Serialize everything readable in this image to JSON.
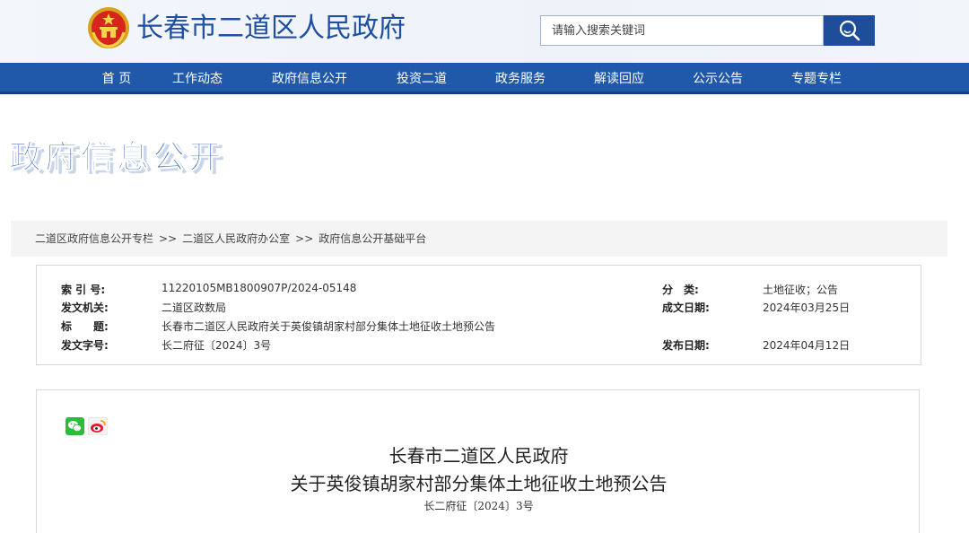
{
  "header": {
    "site_title": "长春市二道区人民政府",
    "search_placeholder": "请输入搜索关键词"
  },
  "nav": {
    "items": [
      "首 页",
      "工作动态",
      "政府信息公开",
      "投资二道",
      "政务服务",
      "解读回应",
      "公示公告",
      "专题专栏"
    ]
  },
  "section": {
    "title": "政府信息公开"
  },
  "breadcrumb": {
    "items": [
      "二道区政府信息公开专栏",
      "二道区人民政府办公室",
      "政府信息公开基础平台"
    ],
    "separator": ">>"
  },
  "meta": {
    "index_label": "索 引 号:",
    "index_value": "11220105MB1800907P/2024-05148",
    "issuer_label": "发文机关:",
    "issuer_value": "二道区政数局",
    "title_label": "标　　题:",
    "title_value": "长春市二道区人民政府关于英俊镇胡家村部分集体土地征收土地预公告",
    "docno_label": "发文字号:",
    "docno_value": "长二府征〔2024〕3号",
    "category_label": "分　类:",
    "category_value": "土地征收；公告",
    "created_label": "成文日期:",
    "created_value": "2024年03月25日",
    "published_label": "发布日期:",
    "published_value": "2024年04月12日"
  },
  "article": {
    "title_line1": "长春市二道区人民政府",
    "title_line2": "关于英俊镇胡家村部分集体土地征收土地预公告",
    "doc_number": "长二府征〔2024〕3号"
  },
  "colors": {
    "brand_blue": "#2159aa",
    "title_blue": "#1f4fa0"
  }
}
